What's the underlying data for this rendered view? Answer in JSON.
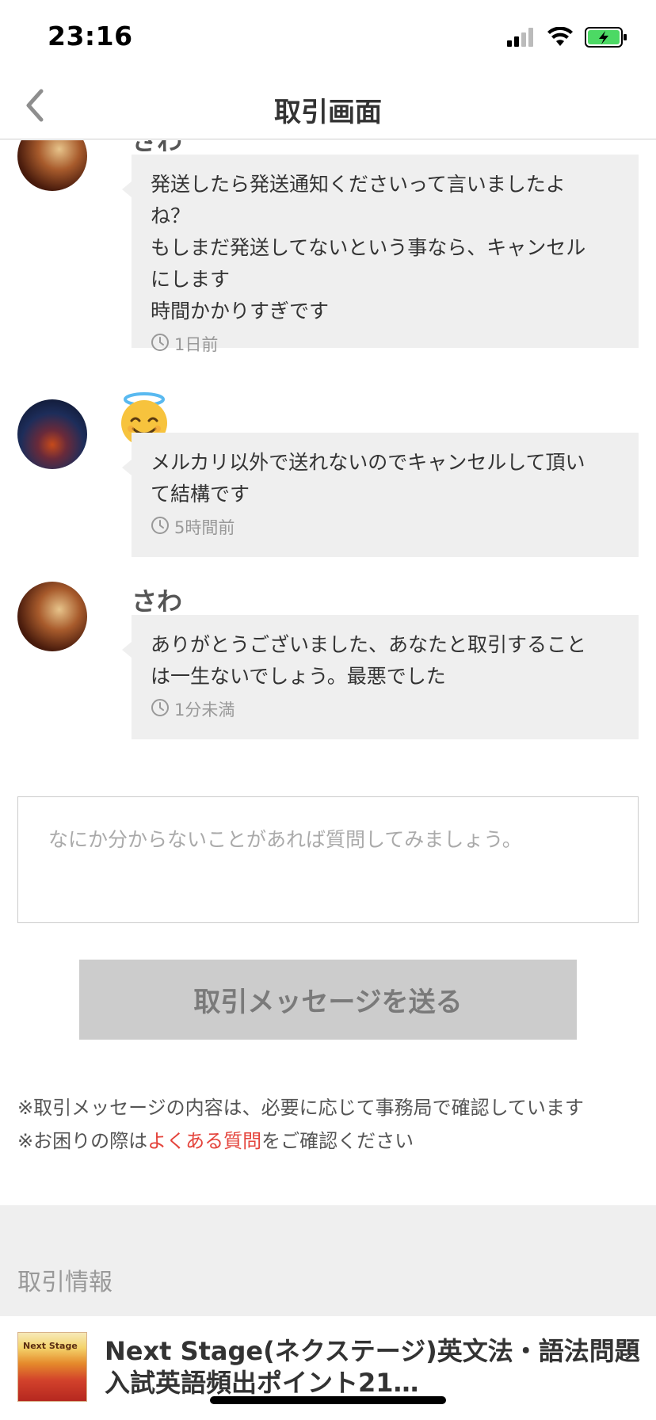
{
  "status_bar": {
    "time": "23:16",
    "icons": [
      "cellular-signal-icon",
      "wifi-icon",
      "battery-charging-icon"
    ],
    "battery_color": "#4cd964"
  },
  "nav": {
    "title": "取引画面",
    "back_icon": "chevron-left-icon"
  },
  "messages": [
    {
      "sender": "さわ",
      "text": "発送したら発送通知くださいって言いましたよ\nね？\nもしまだ発送してないという事なら、キャンセル\nにします\n時間かかりすぎです",
      "time": "1日前"
    },
    {
      "sender": "",
      "sender_icon": "smiling-face-with-halo-icon",
      "text": "メルカリ以外で送れないのでキャンセルして頂い\nて結構です",
      "time": "5時間前"
    },
    {
      "sender": "さわ",
      "text": "ありがとうございました、あなたと取引すること\nは一生ないでしょう。最悪でした",
      "time": "1分未満"
    }
  ],
  "composer": {
    "placeholder": "なにか分からないことがあれば質問してみましょう。",
    "send_label": "取引メッセージを送る"
  },
  "notes": {
    "line1": "※取引メッセージの内容は、必要に応じて事務局で確認しています",
    "line2_prefix": "※お困りの際は",
    "line2_link": "よくある質問",
    "line2_suffix": "をご確認ください"
  },
  "transaction_info": {
    "section_title": "取引情報",
    "item_title": "Next Stage(ネクステージ)英文法・語法問題 入試英語頻出ポイント21…",
    "thumb_label": "Next Stage"
  },
  "colors": {
    "accent_link": "#e4443c",
    "bubble_bg": "#efefef",
    "button_bg": "#cccccc"
  }
}
